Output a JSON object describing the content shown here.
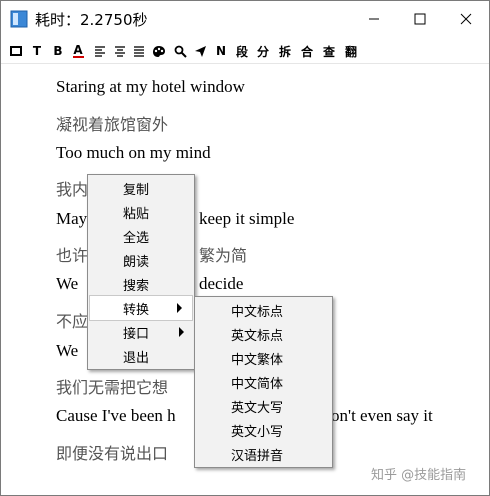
{
  "window": {
    "title": "耗时：2.2750秒"
  },
  "titlebar_buttons": {
    "minimize_icon": "minimize-icon",
    "maximize_icon": "maximize-icon",
    "close_icon": "close-icon"
  },
  "toolbar": {
    "items": [
      {
        "name": "frame-icon",
        "label": ""
      },
      {
        "name": "text-tool",
        "label": "T"
      },
      {
        "name": "bold-tool",
        "label": "B"
      },
      {
        "name": "font-color-tool",
        "label": "A"
      },
      {
        "name": "align-left-icon",
        "label": ""
      },
      {
        "name": "align-center-icon",
        "label": ""
      },
      {
        "name": "align-justify-icon",
        "label": ""
      },
      {
        "name": "palette-icon",
        "label": ""
      },
      {
        "name": "search-icon",
        "label": ""
      },
      {
        "name": "send-icon",
        "label": ""
      },
      {
        "name": "n-tool",
        "label": "N"
      },
      {
        "name": "segment-tool",
        "label": "段"
      },
      {
        "name": "split-tool",
        "label": "分"
      },
      {
        "name": "break-tool",
        "label": "拆"
      },
      {
        "name": "merge-tool",
        "label": "合"
      },
      {
        "name": "check-tool",
        "label": "查"
      },
      {
        "name": "translate-tool",
        "label": "翻"
      }
    ]
  },
  "content": {
    "lines": [
      {
        "lang": "en",
        "text": "Staring at my hotel window"
      },
      {
        "lang": "zh",
        "text": "凝视着旅馆窗外"
      },
      {
        "lang": "en",
        "text": "Too much on my mind"
      },
      {
        "lang": "zh",
        "text": "我内"
      },
      {
        "lang": "en",
        "text": "May"
      },
      {
        "lang": "en",
        "text": "keep it simple"
      },
      {
        "lang": "zh",
        "text": "也许"
      },
      {
        "lang": "zh",
        "text": "繁为简"
      },
      {
        "lang": "en",
        "text": "We"
      },
      {
        "lang": "en",
        "text": "decide"
      },
      {
        "lang": "zh",
        "text": "不应"
      },
      {
        "lang": "en",
        "text": "We"
      },
      {
        "lang": "zh",
        "text": "我们无需把它想"
      },
      {
        "lang": "en",
        "text": "Cause I've been h"
      },
      {
        "lang": "en",
        "text": "on't even say it"
      },
      {
        "lang": "zh",
        "text": "即便没有说出口"
      }
    ]
  },
  "context_menu": {
    "items": [
      {
        "label": "复制",
        "has_submenu": false
      },
      {
        "label": "粘贴",
        "has_submenu": false
      },
      {
        "label": "全选",
        "has_submenu": false
      },
      {
        "label": "朗读",
        "has_submenu": false
      },
      {
        "label": "搜索",
        "has_submenu": false
      },
      {
        "label": "转换",
        "has_submenu": true,
        "highlighted": true
      },
      {
        "label": "接口",
        "has_submenu": true
      },
      {
        "label": "退出",
        "has_submenu": false
      }
    ]
  },
  "submenu": {
    "items": [
      {
        "label": "中文标点"
      },
      {
        "label": "英文标点"
      },
      {
        "label": "中文繁体"
      },
      {
        "label": "中文简体"
      },
      {
        "label": "英文大写"
      },
      {
        "label": "英文小写"
      },
      {
        "label": "汉语拼音"
      }
    ]
  },
  "watermark": {
    "text": "知乎 @技能指南"
  },
  "colors": {
    "menu_bg": "#f2f2f2",
    "menu_border": "#8c8c8c",
    "text_en": "#000000",
    "text_zh": "#555555",
    "icon_blue": "#3b87d6"
  }
}
